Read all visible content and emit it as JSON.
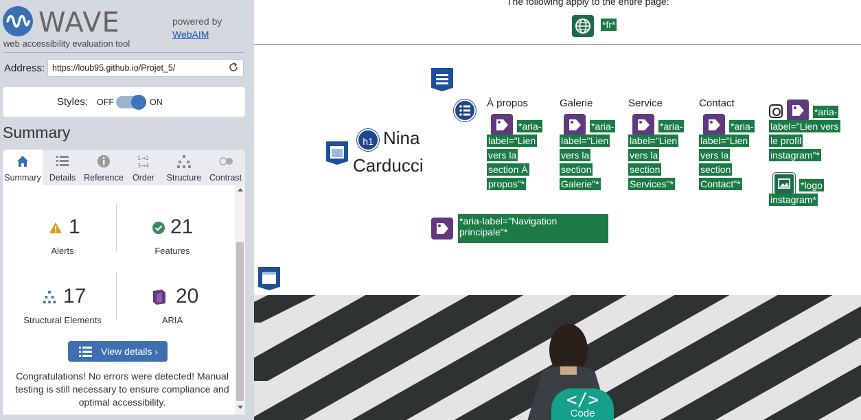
{
  "sidebar": {
    "brand": {
      "name": "WAVE",
      "tagline": "web accessibility evaluation tool",
      "powered_by": "powered by",
      "link": "WebAIM"
    },
    "address": {
      "label": "Address:",
      "value": "https://loub95.github.io/Projet_5/"
    },
    "styles": {
      "label": "Styles:",
      "off": "OFF",
      "on": "ON",
      "state": "on"
    },
    "summary_title": "Summary",
    "tabs": [
      {
        "label": "Summary",
        "icon": "home-icon",
        "active": true
      },
      {
        "label": "Details",
        "icon": "list-icon"
      },
      {
        "label": "Reference",
        "icon": "info-icon"
      },
      {
        "label": "Order",
        "icon": "order-icon"
      },
      {
        "label": "Structure",
        "icon": "structure-icon"
      },
      {
        "label": "Contrast",
        "icon": "contrast-icon"
      }
    ],
    "stats": {
      "alerts": {
        "count": "1",
        "label": "Alerts",
        "icon": "alert-icon",
        "color": "#e09a1c"
      },
      "features": {
        "count": "21",
        "label": "Features",
        "icon": "check-icon",
        "color": "#3c8a5a"
      },
      "structural": {
        "count": "17",
        "label": "Structural Elements",
        "icon": "structure-icon",
        "color": "#3a6fb5"
      },
      "aria": {
        "count": "20",
        "label": "ARIA",
        "icon": "aria-icon",
        "color": "#60397e"
      }
    },
    "view_details": "View details ›",
    "congrats": "Congratulations! No errors were detected! Manual testing is still necessary to ensure compliance and optimal accessibility."
  },
  "page": {
    "apply_text": "The following apply to the entire page:",
    "lang": "*fr*",
    "site_name_line1": "Nina",
    "site_name_line2": "Carducci",
    "h1_badge": "h1",
    "nav": [
      {
        "link": "À propos",
        "aria_l1": "*aria-",
        "aria_rest": [
          "label=\"Lien",
          "vers la",
          "section À",
          "propos\"*"
        ]
      },
      {
        "link": "Galerie",
        "aria_l1": "*aria-",
        "aria_rest": [
          "label=\"Lien",
          "vers la",
          "section",
          "Galerie\"*"
        ]
      },
      {
        "link": "Service",
        "aria_l1": "*aria-",
        "aria_rest": [
          "label=\"Lien",
          "vers la",
          "section",
          "Services\"*"
        ]
      },
      {
        "link": "Contact",
        "aria_l1": "*aria-",
        "aria_rest": [
          "label=\"Lien",
          "vers la",
          "section",
          "Contact\"*"
        ]
      }
    ],
    "instagram": {
      "aria_l1": "*aria-",
      "aria_rest": [
        "label=\"Lien vers",
        "le profil",
        "instagram\"*"
      ],
      "logo_l1": "*logo",
      "logo_rest": "instagram*"
    },
    "nav_aria_label": "*aria-label=\"Navigation principale\"*",
    "code_badge": {
      "glyph": "</>",
      "label": "Code"
    }
  }
}
